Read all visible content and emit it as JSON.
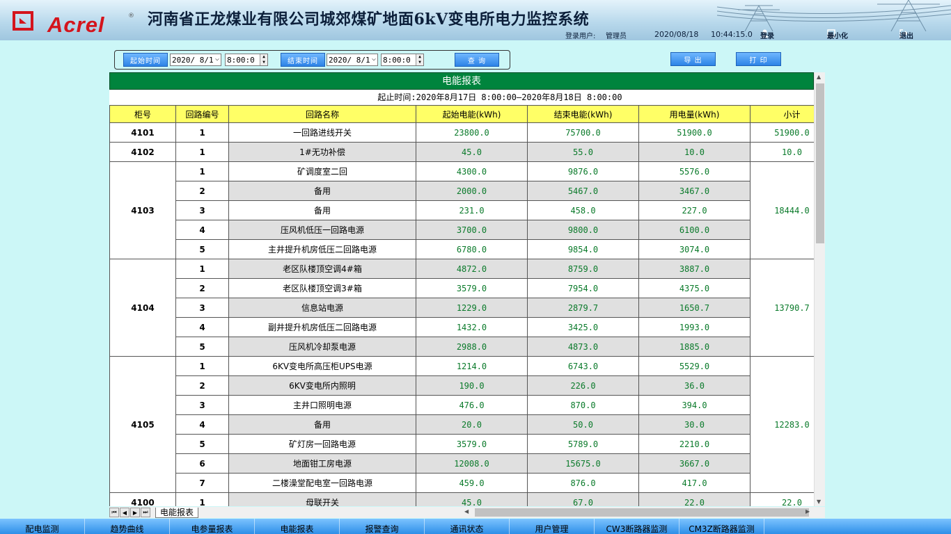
{
  "header": {
    "brand": "Acrel",
    "title": "河南省正龙煤业有限公司城郊煤矿地面6kV变电所电力监控系统",
    "login_user_label": "登录用户:",
    "login_user": "管理员",
    "date": "2020/08/18",
    "time": "10:44:15.0",
    "login_button": "登录",
    "minimize_button": "最小化",
    "exit_button": "退出"
  },
  "toolbar": {
    "start_label": "起始时间",
    "start_date": "2020/ 8/1",
    "start_time": "8:00:0",
    "end_label": "结束时间",
    "end_date": "2020/ 8/1",
    "end_time": "8:00:0",
    "query_button": "查 询",
    "export_button": "导 出",
    "print_button": "打 印"
  },
  "report": {
    "title": "电能报表",
    "period": "起止时间:2020年8月17日 8:00:00—2020年8月18日 8:00:00",
    "columns": [
      "柜号",
      "回路编号",
      "回路名称",
      "起始电能(kWh)",
      "结束电能(kWh)",
      "用电量(kWh)",
      "小计"
    ],
    "groups": [
      {
        "cabinet": "4101",
        "subtotal": "51900.0",
        "rows": [
          {
            "no": "1",
            "name": "一回路进线开关",
            "start": "23800.0",
            "end": "75700.0",
            "usage": "51900.0"
          }
        ]
      },
      {
        "cabinet": "4102",
        "subtotal": "10.0",
        "rows": [
          {
            "no": "1",
            "name": "1#无功补偿",
            "start": "45.0",
            "end": "55.0",
            "usage": "10.0"
          }
        ]
      },
      {
        "cabinet": "4103",
        "subtotal": "18444.0",
        "rows": [
          {
            "no": "1",
            "name": "矿调度室二回",
            "start": "4300.0",
            "end": "9876.0",
            "usage": "5576.0"
          },
          {
            "no": "2",
            "name": "备用",
            "start": "2000.0",
            "end": "5467.0",
            "usage": "3467.0"
          },
          {
            "no": "3",
            "name": "备用",
            "start": "231.0",
            "end": "458.0",
            "usage": "227.0"
          },
          {
            "no": "4",
            "name": "压风机低压一回路电源",
            "start": "3700.0",
            "end": "9800.0",
            "usage": "6100.0"
          },
          {
            "no": "5",
            "name": "主井提升机房低压二回路电源",
            "start": "6780.0",
            "end": "9854.0",
            "usage": "3074.0"
          }
        ]
      },
      {
        "cabinet": "4104",
        "subtotal": "13790.7",
        "rows": [
          {
            "no": "1",
            "name": "老区队楼顶空调4#箱",
            "start": "4872.0",
            "end": "8759.0",
            "usage": "3887.0"
          },
          {
            "no": "2",
            "name": "老区队楼顶空调3#箱",
            "start": "3579.0",
            "end": "7954.0",
            "usage": "4375.0"
          },
          {
            "no": "3",
            "name": "信息站电源",
            "start": "1229.0",
            "end": "2879.7",
            "usage": "1650.7"
          },
          {
            "no": "4",
            "name": "副井提升机房低压二回路电源",
            "start": "1432.0",
            "end": "3425.0",
            "usage": "1993.0"
          },
          {
            "no": "5",
            "name": "压风机冷却泵电源",
            "start": "2988.0",
            "end": "4873.0",
            "usage": "1885.0"
          }
        ]
      },
      {
        "cabinet": "4105",
        "subtotal": "12283.0",
        "rows": [
          {
            "no": "1",
            "name": "6KV变电所高压柜UPS电源",
            "start": "1214.0",
            "end": "6743.0",
            "usage": "5529.0"
          },
          {
            "no": "2",
            "name": "6KV变电所内照明",
            "start": "190.0",
            "end": "226.0",
            "usage": "36.0"
          },
          {
            "no": "3",
            "name": "主井口照明电源",
            "start": "476.0",
            "end": "870.0",
            "usage": "394.0"
          },
          {
            "no": "4",
            "name": "备用",
            "start": "20.0",
            "end": "50.0",
            "usage": "30.0"
          },
          {
            "no": "5",
            "name": "矿灯房一回路电源",
            "start": "3579.0",
            "end": "5789.0",
            "usage": "2210.0"
          },
          {
            "no": "6",
            "name": "地面钳工房电源",
            "start": "12008.0",
            "end": "15675.0",
            "usage": "3667.0"
          },
          {
            "no": "7",
            "name": "二楼澡堂配电室一回路电源",
            "start": "459.0",
            "end": "876.0",
            "usage": "417.0"
          }
        ]
      },
      {
        "cabinet": "4100",
        "subtotal": "22.0",
        "rows": [
          {
            "no": "1",
            "name": "母联开关",
            "start": "45.0",
            "end": "67.0",
            "usage": "22.0"
          }
        ]
      }
    ]
  },
  "sheet_tab": "电能报表",
  "bottom_nav": [
    "配电监测",
    "趋势曲线",
    "电参量报表",
    "电能报表",
    "报警查询",
    "通讯状态",
    "用户管理",
    "CW3断路器监测",
    "CM3Z断路器监测"
  ]
}
